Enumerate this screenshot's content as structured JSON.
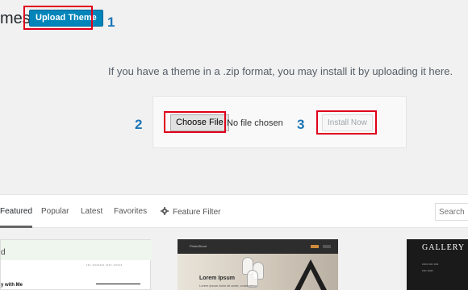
{
  "page": {
    "title_fragment": "mes",
    "upload_theme_label": "Upload Theme",
    "help_text": "If you have a theme in a .zip format, you may install it by uploading it here."
  },
  "callouts": [
    "1",
    "2",
    "3"
  ],
  "upload_form": {
    "choose_file_label": "Choose File",
    "no_file_text": "No file chosen",
    "install_label": "Install Now"
  },
  "filter_bar": {
    "tabs": [
      "Featured",
      "Popular",
      "Latest",
      "Favorites"
    ],
    "feature_filter_label": "Feature Filter",
    "search_placeholder": "Search"
  },
  "themes": {
    "card1": {
      "letter": "d",
      "nav": "••• •••••••• •••• ••••••",
      "title": "y with Me"
    },
    "card2": {
      "logo": "PhotoShoot",
      "hero_title": "Lorem Ipsum",
      "hero_sub": "Lorem ipsum dolor sit amet, consectetur."
    },
    "card3": {
      "logo": "GALLERY",
      "sub1": "••••• •••• ••••",
      "sub2": "•••• •••••"
    }
  },
  "colors": {
    "primary_button": "#0085ba",
    "callout_border": "#e0001b",
    "step_number": "#1b75b6"
  },
  "icons": {
    "feature_filter": "gear-icon"
  }
}
